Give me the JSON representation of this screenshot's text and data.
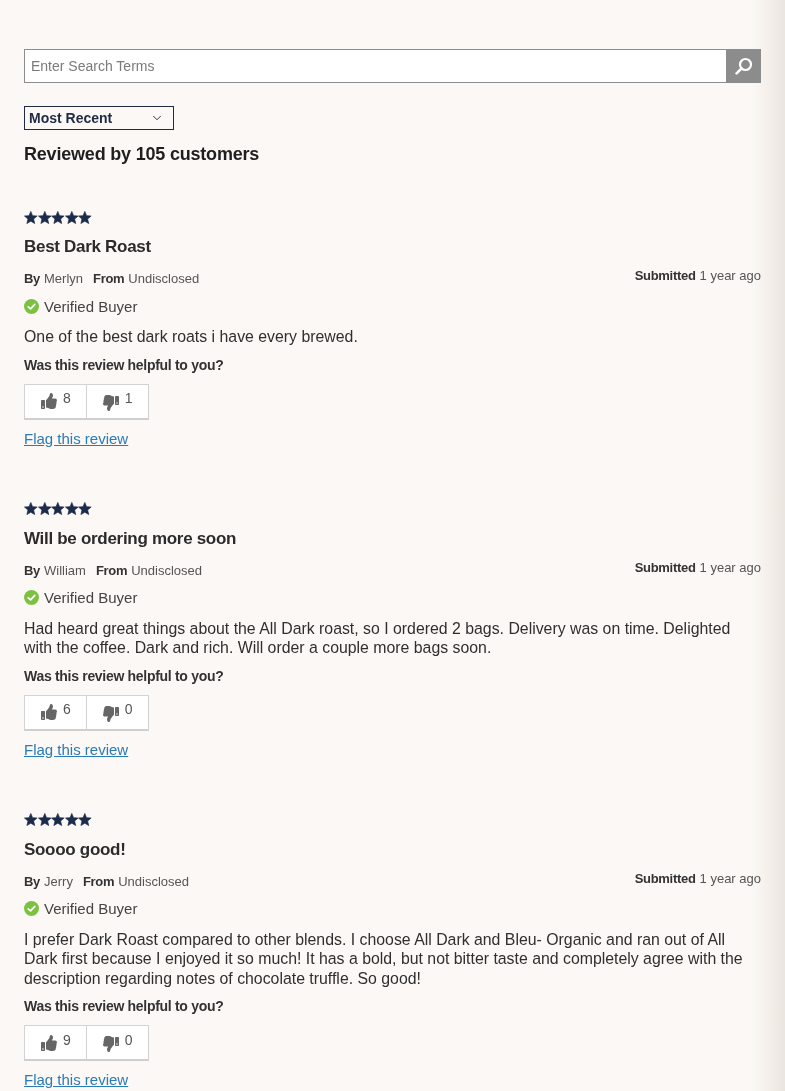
{
  "search": {
    "placeholder": "Enter Search Terms"
  },
  "sort": {
    "value": "Most Recent"
  },
  "summary": "Reviewed by 105 customers",
  "reviews": [
    {
      "stars": 5,
      "title": "Best Dark Roast",
      "author_label": "By",
      "author": "Merlyn",
      "location_label": "From",
      "location": "Undisclosed",
      "submitted_label": "Submitted",
      "submitted": "1 year ago",
      "verified": true,
      "verified_label": "Verified Buyer",
      "text": "One of the best dark roats i have every brewed.",
      "helpful_question": "Was this review helpful to you?",
      "votes_up": "8",
      "votes_down": "1",
      "flag": "Flag this review"
    },
    {
      "stars": 5,
      "title": "Will be ordering more soon",
      "author_label": "By",
      "author": "William",
      "location_label": "From",
      "location": "Undisclosed",
      "submitted_label": "Submitted",
      "submitted": "1 year ago",
      "verified": true,
      "verified_label": "Verified Buyer",
      "text": "Had heard great things about the All Dark roast, so I ordered 2 bags. Delivery was on time. Delighted with the coffee. Dark and rich. Will order a couple more bags soon.",
      "helpful_question": "Was this review helpful to you?",
      "votes_up": "6",
      "votes_down": "0",
      "flag": "Flag this review"
    },
    {
      "stars": 5,
      "title": "Soooo good!",
      "author_label": "By",
      "author": "Jerry",
      "location_label": "From",
      "location": "Undisclosed",
      "submitted_label": "Submitted",
      "submitted": "1 year ago",
      "verified": true,
      "verified_label": "Verified Buyer",
      "text": "I prefer Dark Roast compared to other blends. I choose All Dark and Bleu- Organic and ran out of All Dark first because I enjoyed it so much! It has a bold, but not bitter taste and completely agree with the description regarding notes of chocolate truffle. So good!",
      "helpful_question": "Was this review helpful to you?",
      "votes_up": "9",
      "votes_down": "0",
      "flag": "Flag this review"
    }
  ]
}
